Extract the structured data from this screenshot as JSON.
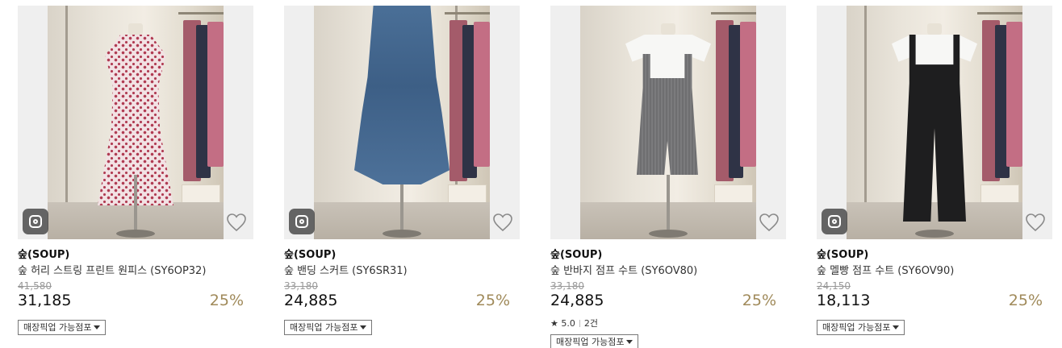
{
  "products": [
    {
      "brand": "숲(SOUP)",
      "name": "숲 허리 스트링 프린트 원피스 (SY6OP32)",
      "original_price": "41,580",
      "price": "31,185",
      "discount": "25%",
      "pickup_label": "매장픽업 가능점포"
    },
    {
      "brand": "숲(SOUP)",
      "name": "숲 밴딩 스커트 (SY6SR31)",
      "original_price": "33,180",
      "price": "24,885",
      "discount": "25%",
      "pickup_label": "매장픽업 가능점포"
    },
    {
      "brand": "숲(SOUP)",
      "name": "숲 반바지 점프 수트 (SY6OV80)",
      "original_price": "33,180",
      "price": "24,885",
      "discount": "25%",
      "rating": "★ 5.0",
      "review_count": "2건",
      "pickup_label": "매장픽업 가능점포"
    },
    {
      "brand": "숲(SOUP)",
      "name": "숲 멜빵 점프 수트 (SY6OV90)",
      "original_price": "24,150",
      "price": "18,113",
      "discount": "25%",
      "pickup_label": "매장픽업 가능점포"
    }
  ],
  "colors": {
    "discount": "#a08a5a",
    "strike_price": "#999999"
  }
}
